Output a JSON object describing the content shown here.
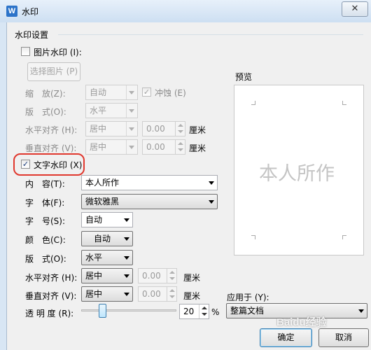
{
  "window": {
    "title": "水印",
    "app_icon_letter": "W",
    "close_glyph": "✕"
  },
  "group": {
    "title": "水印设置"
  },
  "picture": {
    "checkbox_label": "图片水印 (I):",
    "select_button": "选择图片 (P)",
    "scale_label": "缩　放(Z):",
    "scale_value": "自动",
    "washout_label": "冲蚀 (E)",
    "layout_label": "版　式(O):",
    "layout_value": "水平",
    "halign_label": "水平对齐 (H):",
    "halign_value": "居中",
    "halign_offset": "0.00",
    "halign_unit": "厘米",
    "valign_label": "垂直对齐 (V):",
    "valign_value": "居中",
    "valign_offset": "0.00",
    "valign_unit": "厘米"
  },
  "text": {
    "checkbox_label": "文字水印 (X)",
    "checked": true,
    "content_label": "内　容(T):",
    "content_value": "本人所作",
    "font_label": "字　体(F):",
    "font_value": "微软雅黑",
    "size_label": "字　号(S):",
    "size_value": "自动",
    "color_label": "颜　色(C):",
    "color_value": "自动",
    "layout_label": "版　式(O):",
    "layout_value": "水平",
    "halign_label": "水平对齐 (H):",
    "halign_value": "居中",
    "halign_offset": "0.00",
    "halign_unit": "厘米",
    "valign_label": "垂直对齐 (V):",
    "valign_value": "居中",
    "valign_offset": "0.00",
    "valign_unit": "厘米",
    "transparency_label": "透 明 度 (R):",
    "transparency_value": "20",
    "transparency_unit": "%",
    "transparency_fraction": 0.2
  },
  "preview": {
    "label": "预览",
    "watermark_text": "本人所作"
  },
  "apply": {
    "label": "应用于 (Y):",
    "value": "整篇文档"
  },
  "buttons": {
    "ok": "确定",
    "cancel": "取消"
  },
  "overlay": {
    "logo_text": "Baidu经验"
  },
  "colors": {
    "highlight": "#e0382e",
    "accent": "#2c73c9"
  }
}
